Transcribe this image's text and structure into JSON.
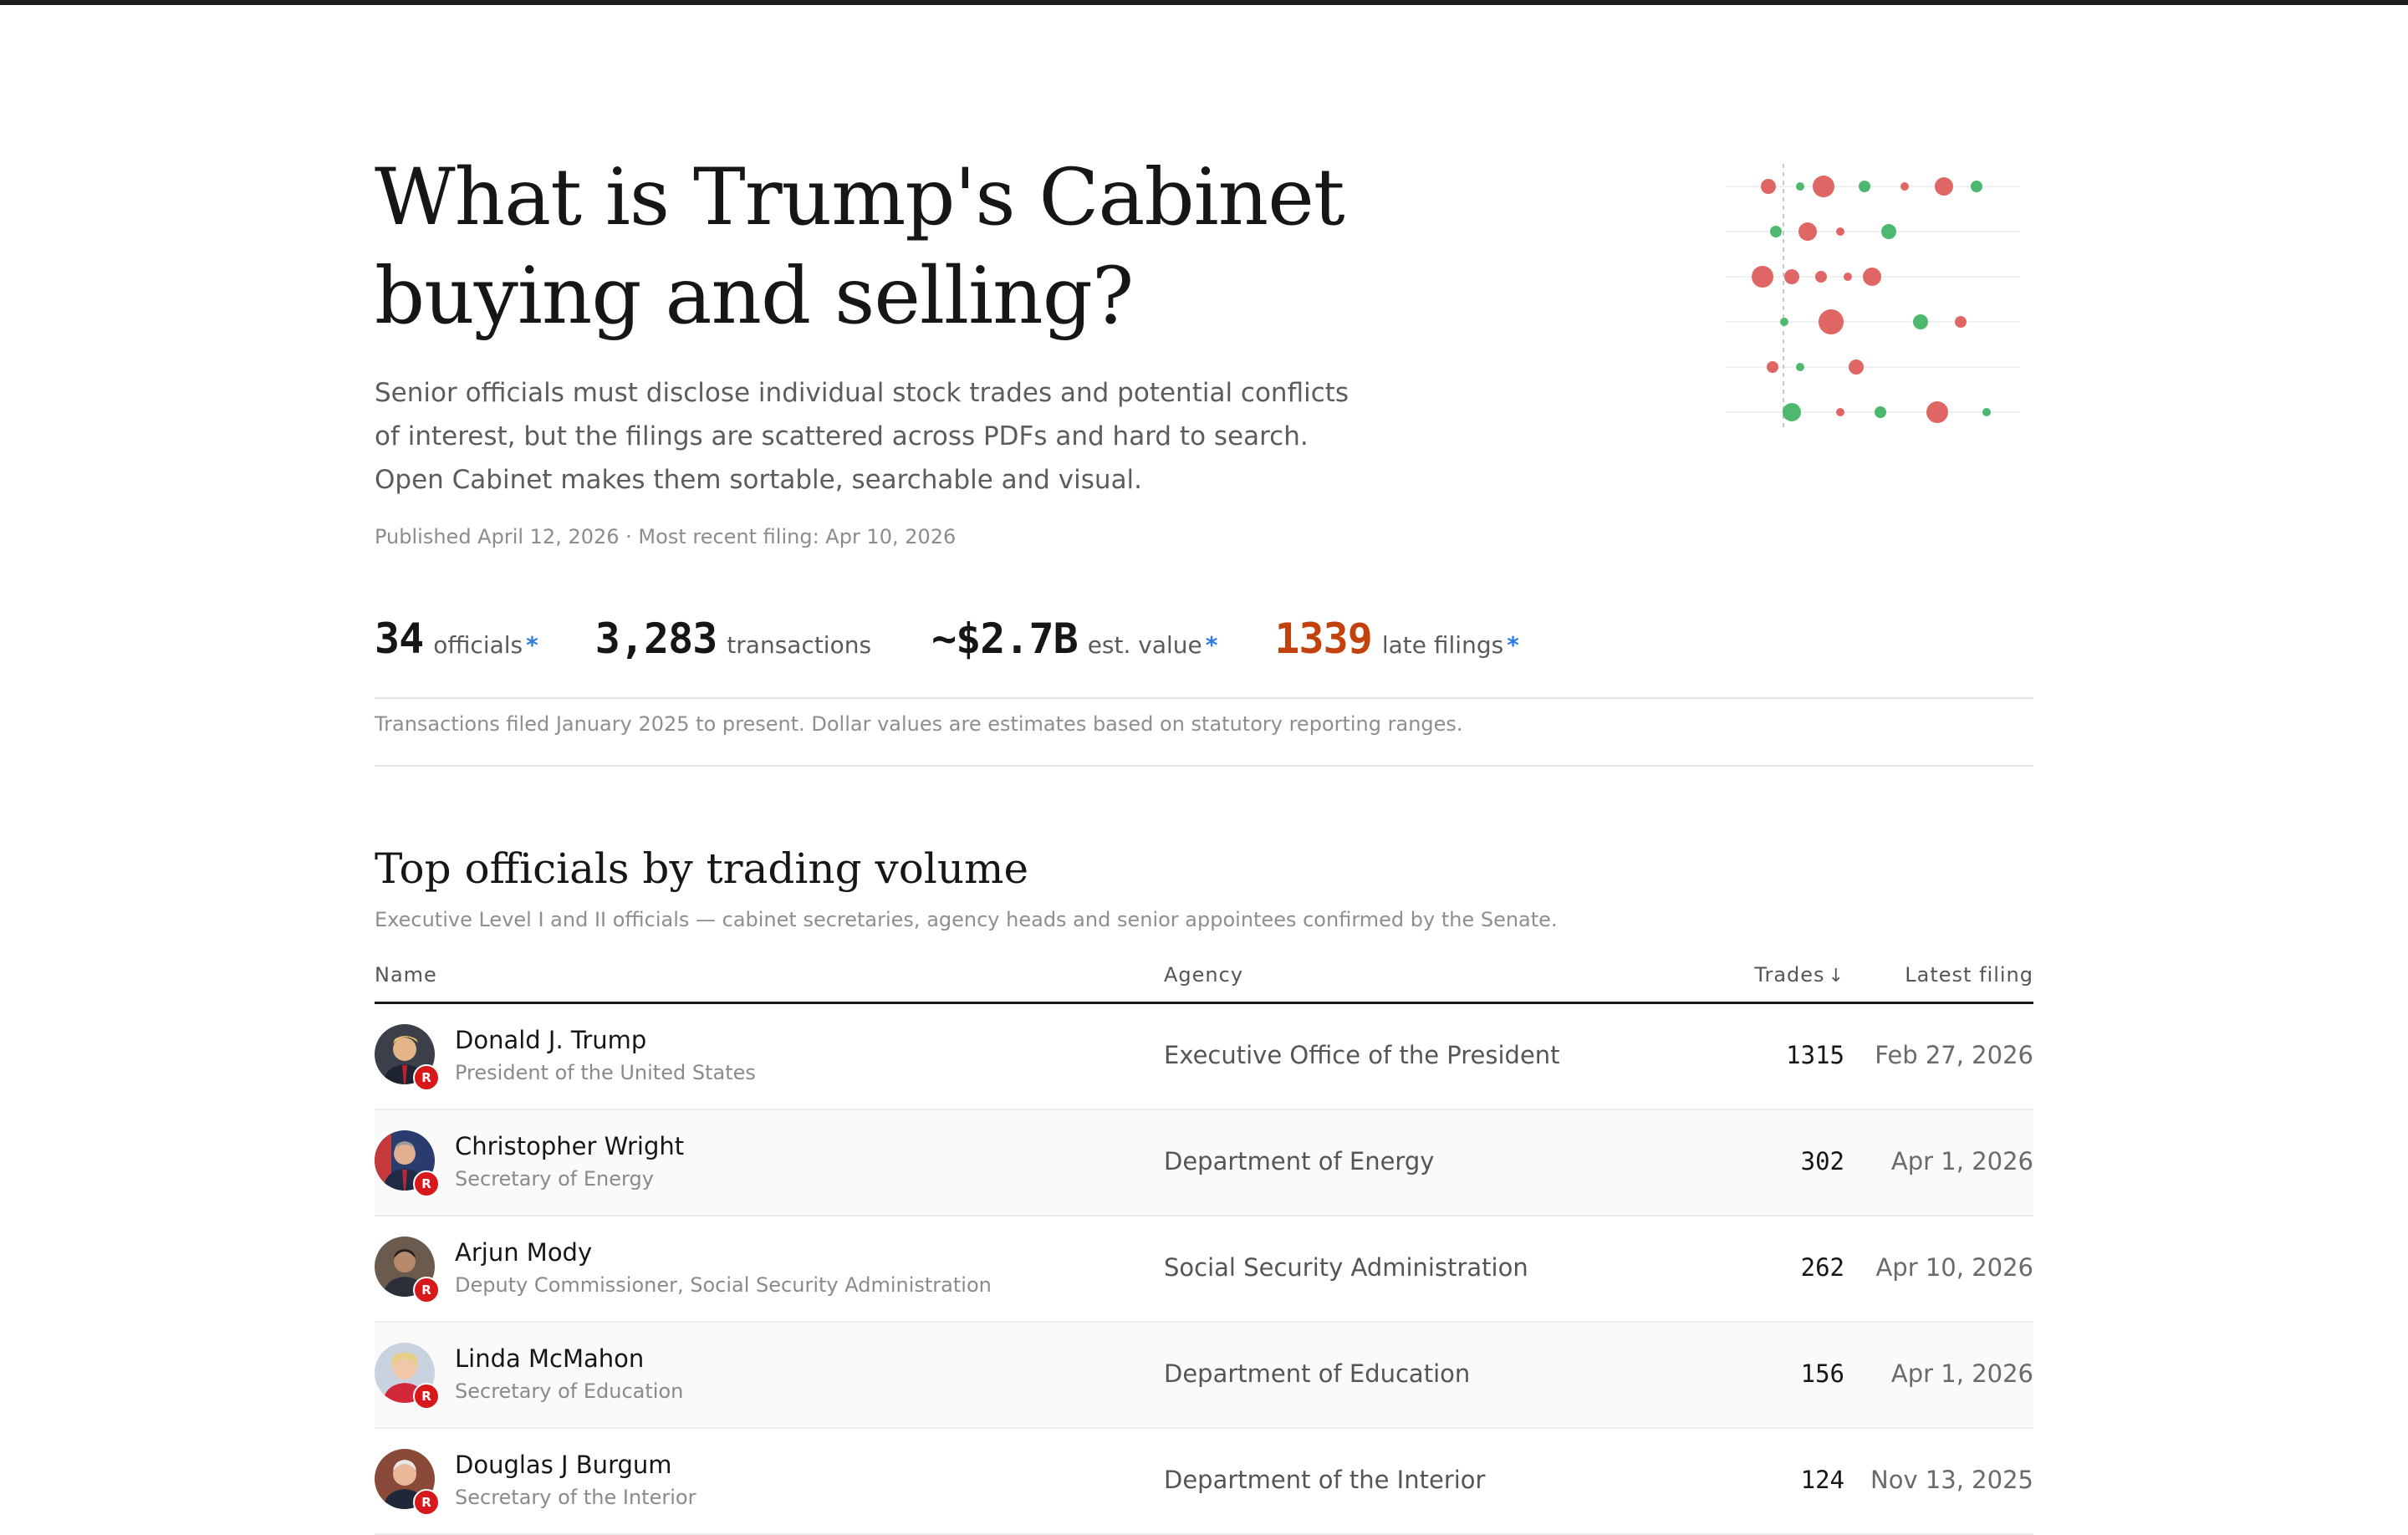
{
  "hero": {
    "title_line1": "What is Trump's Cabinet",
    "title_line2": "buying and selling?",
    "description": "Senior officials must disclose individual stock trades and potential conflicts of interest, but the filings are scattered across PDFs and hard to search. Open Cabinet makes them sortable, searchable and visual.",
    "published": "Published April 12, 2026 · Most recent filing: Apr 10, 2026"
  },
  "stats": [
    {
      "value": "34",
      "label": "officials",
      "asterisk": "*"
    },
    {
      "value": "3,283",
      "label": "transactions",
      "asterisk": ""
    },
    {
      "value": "~$2.7B",
      "label": "est. value",
      "asterisk": "*"
    },
    {
      "value": "1339",
      "label": "late filings",
      "asterisk": "*"
    }
  ],
  "footnote": "Transactions filed January 2025 to present. Dollar values are estimates based on statutory reporting ranges.",
  "section": {
    "title": "Top officials by trading volume",
    "subtitle": "Executive Level I and II officials — cabinet secretaries, agency heads and senior appointees confirmed by the Senate."
  },
  "table": {
    "columns": {
      "name": "Name",
      "agency": "Agency",
      "trades": "Trades",
      "trades_sort_icon": "↓",
      "latest": "Latest filing"
    },
    "rows": [
      {
        "name": "Donald J. Trump",
        "role": "President of the United States",
        "agency": "Executive Office of the President",
        "trades": "1315",
        "latest": "Feb 27, 2026",
        "party": "R"
      },
      {
        "name": "Christopher Wright",
        "role": "Secretary of Energy",
        "agency": "Department of Energy",
        "trades": "302",
        "latest": "Apr 1, 2026",
        "party": "R"
      },
      {
        "name": "Arjun Mody",
        "role": "Deputy Commissioner, Social Security Administration",
        "agency": "Social Security Administration",
        "trades": "262",
        "latest": "Apr 10, 2026",
        "party": "R"
      },
      {
        "name": "Linda McMahon",
        "role": "Secretary of Education",
        "agency": "Department of Education",
        "trades": "156",
        "latest": "Apr 1, 2026",
        "party": "R"
      },
      {
        "name": "Douglas J Burgum",
        "role": "Secretary of the Interior",
        "agency": "Department of the Interior",
        "trades": "124",
        "latest": "Nov 13, 2025",
        "party": "R"
      }
    ]
  },
  "colors": {
    "sell": "#e06666",
    "buy": "#4cb870",
    "late": "#c2410c",
    "asterisk": "#2f7be6",
    "party_r": "#d7191c"
  }
}
